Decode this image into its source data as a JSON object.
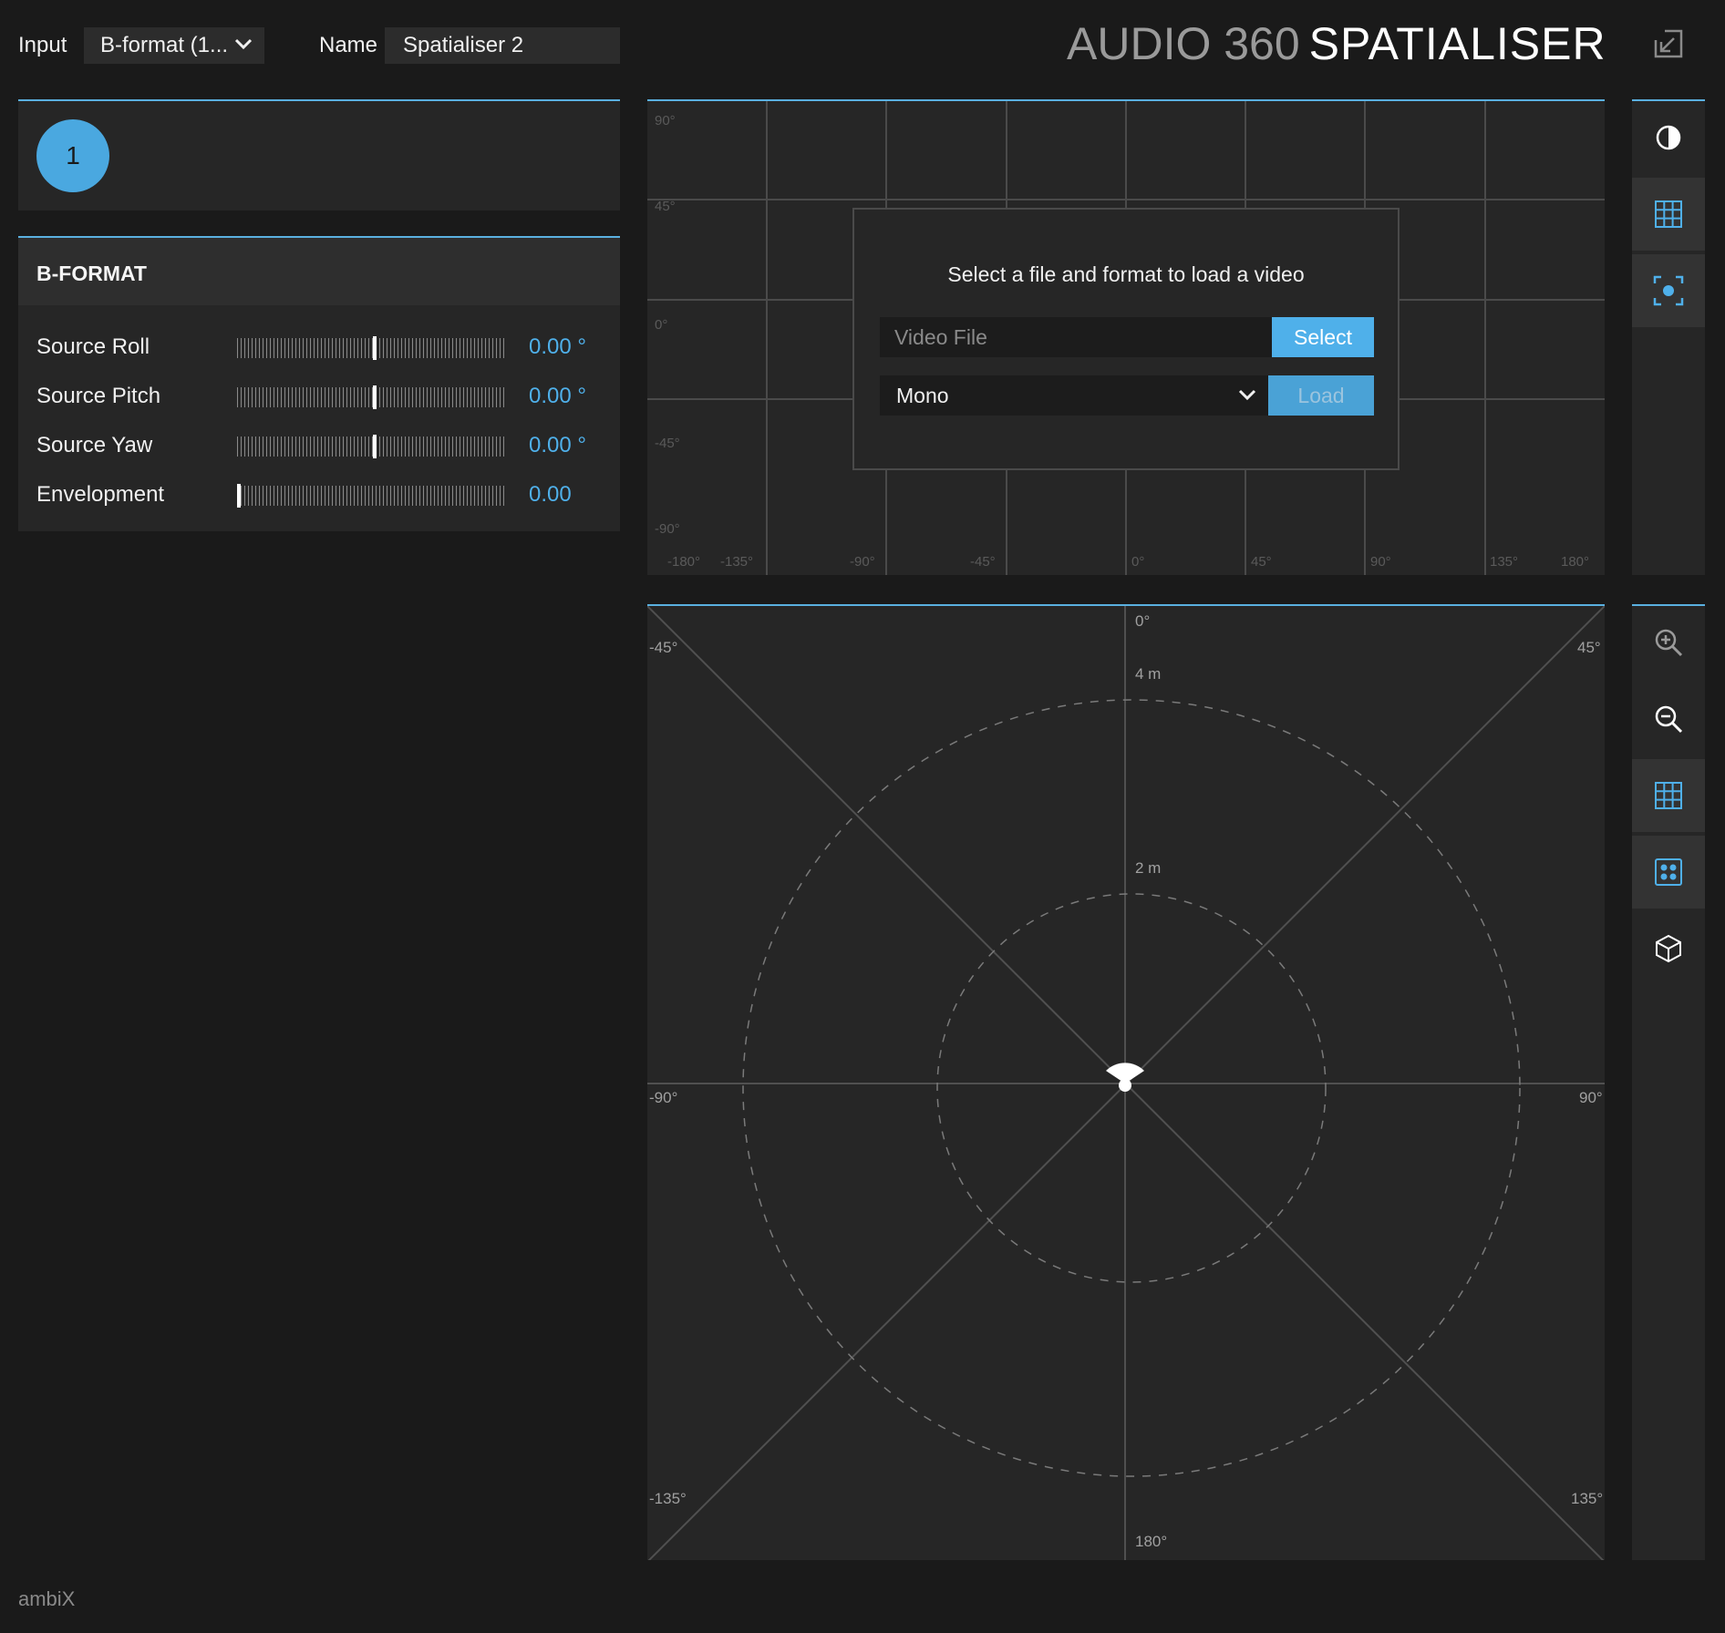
{
  "header": {
    "input_label": "Input",
    "input_value": "B-format (1...",
    "name_label": "Name",
    "name_value": "Spatialiser 2",
    "brand_thin": "AUDIO 360",
    "brand_bold": "SPATIALISER",
    "popout_icon": "popout-arrow-icon"
  },
  "objects": {
    "items": [
      {
        "label": "1",
        "color": "#4aa8e0"
      }
    ]
  },
  "bformat": {
    "title": "B-FORMAT",
    "params": [
      {
        "name": "Source Roll",
        "value": "0.00 °",
        "level": 0.5
      },
      {
        "name": "Source Pitch",
        "value": "0.00 °",
        "level": 0.5
      },
      {
        "name": "Source Yaw",
        "value": "0.00 °",
        "level": 0.5
      },
      {
        "name": "Envelopment",
        "value": "0.00",
        "level": 0.0
      }
    ]
  },
  "video": {
    "y_labels": [
      "90°",
      "45°",
      "0°",
      "-45°",
      "-90°"
    ],
    "x_labels": [
      "-180°",
      "-135°",
      "-90°",
      "-45°",
      "0°",
      "45°",
      "90°",
      "135°",
      "180°"
    ],
    "dialog": {
      "title": "Select a file and format to load a video",
      "file_placeholder": "Video File",
      "select_label": "Select",
      "format_value": "Mono",
      "load_label": "Load"
    }
  },
  "topview": {
    "angles": {
      "front": "0°",
      "front_left": "-45°",
      "front_right": "45°",
      "left": "-90°",
      "right": "90°",
      "back_left": "-135°",
      "back_right": "135°",
      "back": "180°"
    },
    "distances": [
      "4 m",
      "2 m"
    ]
  },
  "toolbar_top": [
    {
      "icon": "contrast-icon",
      "active": false
    },
    {
      "icon": "grid-icon",
      "active": true
    },
    {
      "icon": "focus-target-icon",
      "active": true
    }
  ],
  "toolbar_bottom": [
    {
      "icon": "zoom-in-icon",
      "active": false
    },
    {
      "icon": "zoom-out-icon",
      "active": false
    },
    {
      "icon": "grid-icon",
      "active": true
    },
    {
      "icon": "dots-grid-icon",
      "active": true
    },
    {
      "icon": "cube-icon",
      "active": false
    }
  ],
  "footer": {
    "label": "ambiX"
  },
  "colors": {
    "accent": "#4fb0ea",
    "panel": "#262626",
    "background": "#1a1a1a"
  }
}
